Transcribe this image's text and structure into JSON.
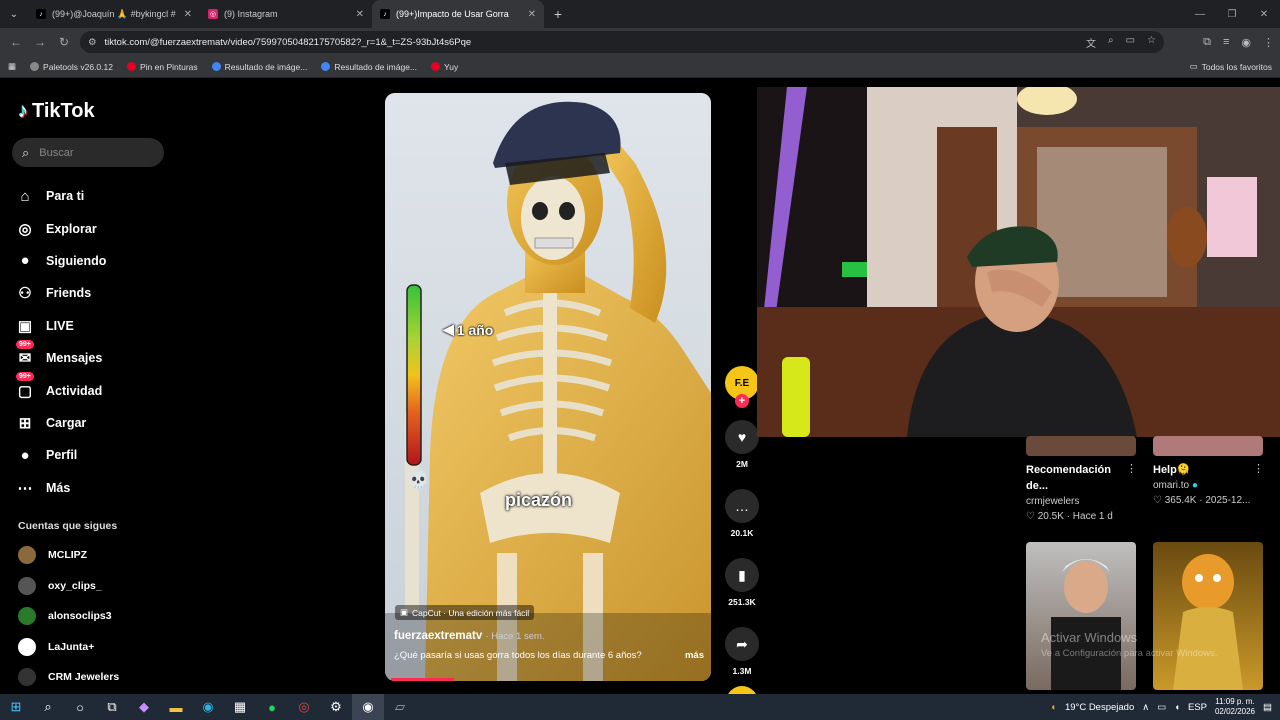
{
  "browser": {
    "tabs": [
      {
        "label": "(99+)@Joaquín 🙏 #bykingcl #",
        "icon": "tiktok-icon"
      },
      {
        "label": "(9) Instagram",
        "icon": "instagram-icon"
      },
      {
        "label": "(99+)Impacto de Usar Gorra",
        "icon": "tiktok-icon",
        "active": true
      }
    ],
    "url": "tiktok.com/@fuerzaextrematv/video/7599705048217570582?_r=1&_t=ZS-93bJt4s6Pqe",
    "bookmarks": [
      "Paletools v26.0.12",
      "Pin en Pinturas",
      "Resultado de imáge...",
      "Resultado de imáge...",
      "Yuy"
    ],
    "bookmarks_right": "Todos los favoritos"
  },
  "sidebar": {
    "logo": "TikTok",
    "search_placeholder": "Buscar",
    "items": [
      {
        "label": "Para ti",
        "icon": "home-icon",
        "glyph": "⌂"
      },
      {
        "label": "Explorar",
        "icon": "compass-icon",
        "glyph": "◎"
      },
      {
        "label": "Siguiendo",
        "icon": "following-icon",
        "glyph": "●"
      },
      {
        "label": "Friends",
        "icon": "friends-icon",
        "glyph": "⚇"
      },
      {
        "label": "LIVE",
        "icon": "live-icon",
        "glyph": "▣"
      },
      {
        "label": "Mensajes",
        "icon": "messages-icon",
        "glyph": "✉",
        "badge": "99+"
      },
      {
        "label": "Actividad",
        "icon": "activity-icon",
        "glyph": "▢",
        "badge": "99+"
      },
      {
        "label": "Cargar",
        "icon": "upload-icon",
        "glyph": "⊞"
      },
      {
        "label": "Perfil",
        "icon": "profile-icon",
        "glyph": "●"
      },
      {
        "label": "Más",
        "icon": "more-icon",
        "glyph": "⋯"
      }
    ],
    "following_title": "Cuentas que sigues",
    "following": [
      {
        "name": "MCLIPZ",
        "color": "#8a6a3a"
      },
      {
        "name": "oxy_clips_",
        "color": "#555555"
      },
      {
        "name": "alonsoclips3",
        "color": "#2a7a2a"
      },
      {
        "name": "LaJunta+",
        "color": "#ffffff"
      },
      {
        "name": "CRM Jewelers",
        "color": "#333333"
      }
    ]
  },
  "video": {
    "meter_label": "1 año",
    "caption_word": "picazón",
    "capcut": "CapCut · Una edición más fácil",
    "author": "fuerzaextrematv",
    "time": "· Hace 1 sem.",
    "description": "¿Qué pasaría si usas gorra todos los días durante 6 años?",
    "more": "más",
    "progress": 0.2
  },
  "actions": {
    "avatar_text": "F.E",
    "likes": "2M",
    "comments": "20.1K",
    "saves": "251.3K",
    "shares": "1.3M"
  },
  "recommendations": [
    {
      "title": "Recomendación de...",
      "author": "crmjewelers",
      "likes": "20.5K",
      "time": "Hace 1 d"
    },
    {
      "title": "Help🫠",
      "author": "omari.to",
      "likes": "365.4K",
      "time": "2025-12..."
    }
  ],
  "overlay": {
    "watermark": "Activar Windows",
    "watermark_sub": "Ve a Configuración para activar Windows."
  },
  "taskbar": {
    "weather": "19°C  Despejado",
    "lang": "ESP",
    "time": "11:09 p. m.",
    "date": "02/02/2026"
  }
}
